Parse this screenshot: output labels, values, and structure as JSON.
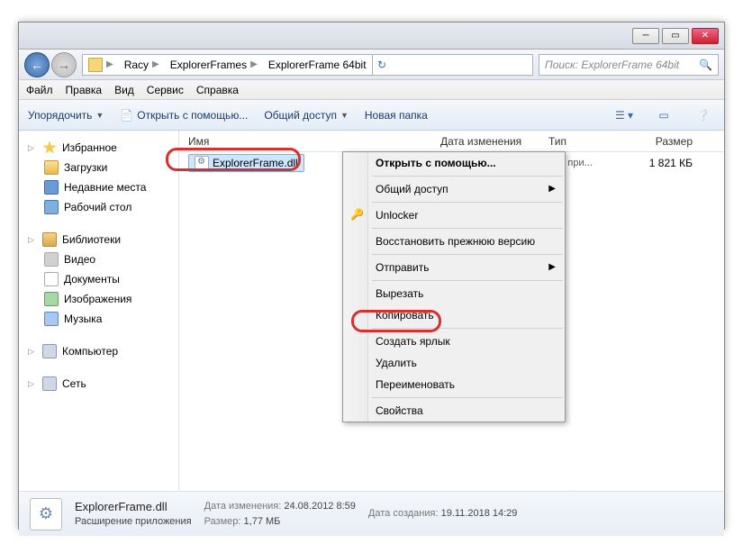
{
  "titlebar": {
    "min": "─",
    "max": "▭",
    "close": "✕"
  },
  "nav": {
    "back": "←",
    "fwd": "→",
    "breadcrumb": [
      "Racy",
      "ExplorerFrames",
      "ExplorerFrame 64bit"
    ],
    "refresh": "↻",
    "search_placeholder": "Поиск: ExplorerFrame 64bit",
    "search_icon": "🔍"
  },
  "menubar": [
    "Файл",
    "Правка",
    "Вид",
    "Сервис",
    "Справка"
  ],
  "toolbar": {
    "organize": "Упорядочить",
    "open_with": "Открыть с помощью...",
    "share": "Общий доступ",
    "new_folder": "Новая папка"
  },
  "columns": {
    "name": "Имя",
    "date": "Дата изменения",
    "type": "Тип",
    "size": "Размер"
  },
  "sidebar": {
    "favorites": {
      "label": "Избранное",
      "items": [
        "Загрузки",
        "Недавние места",
        "Рабочий стол"
      ]
    },
    "libraries": {
      "label": "Библиотеки",
      "items": [
        "Видео",
        "Документы",
        "Изображения",
        "Музыка"
      ]
    },
    "computer": "Компьютер",
    "network": "Сеть"
  },
  "file": {
    "name": "ExplorerFrame.dll",
    "type_trunc": "ние при...",
    "size": "1 821 КБ"
  },
  "context": {
    "open_with": "Открыть с помощью...",
    "share": "Общий доступ",
    "unlocker": "Unlocker",
    "restore": "Восстановить прежнюю версию",
    "send_to": "Отправить",
    "cut": "Вырезать",
    "copy": "Копировать",
    "shortcut": "Создать ярлык",
    "delete": "Удалить",
    "rename": "Переименовать",
    "props": "Свойства"
  },
  "details": {
    "name": "ExplorerFrame.dll",
    "subtype": "Расширение приложения",
    "mod_lbl": "Дата изменения:",
    "mod_val": "24.08.2012 8:59",
    "size_lbl": "Размер:",
    "size_val": "1,77 МБ",
    "created_lbl": "Дата создания:",
    "created_val": "19.11.2018 14:29"
  }
}
